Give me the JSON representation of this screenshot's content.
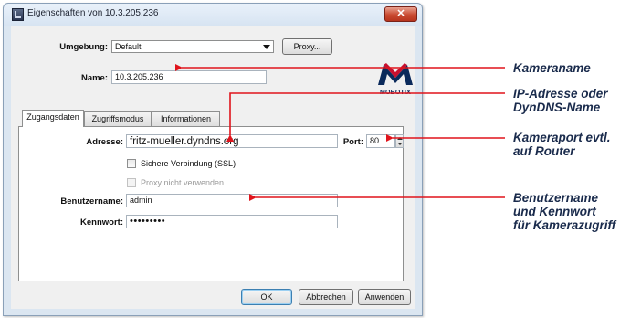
{
  "window": {
    "title": "Eigenschaften von 10.3.205.236",
    "close_symbol": "✕"
  },
  "umgebung": {
    "label": "Umgebung:",
    "value": "Default",
    "proxy_button": "Proxy..."
  },
  "name": {
    "label": "Name:",
    "value": "10.3.205.236"
  },
  "logo": {
    "text": "MOBOTIX",
    "color": "#0b2a5b"
  },
  "tabs": [
    {
      "label": "Zugangsdaten",
      "active": true
    },
    {
      "label": "Zugriffsmodus",
      "active": false
    },
    {
      "label": "Informationen",
      "active": false
    }
  ],
  "zugang": {
    "adresse_label": "Adresse:",
    "adresse_value": "fritz-mueller.dyndns.org",
    "port_label": "Port:",
    "port_value": "80",
    "ssl_label": "Sichere Verbindung (SSL)",
    "ssl_checked": false,
    "proxy_label": "Proxy nicht verwenden",
    "proxy_enabled": false,
    "benutzer_label": "Benutzername:",
    "benutzer_value": "admin",
    "kennwort_label": "Kennwort:",
    "kennwort_value": "•••••••••"
  },
  "buttons": {
    "ok": "OK",
    "abbrechen": "Abbrechen",
    "anwenden": "Anwenden"
  },
  "annotations": {
    "color_arrow": "#e0141c",
    "items": [
      {
        "lines": [
          "Kameraname"
        ]
      },
      {
        "lines": [
          "IP-Adresse oder",
          "DynDNS-Name"
        ]
      },
      {
        "lines": [
          "Kameraport evtl.",
          "auf Router"
        ]
      },
      {
        "lines": [
          "Benutzername",
          "und Kennwort",
          "für Kamerazugriff"
        ]
      }
    ]
  }
}
